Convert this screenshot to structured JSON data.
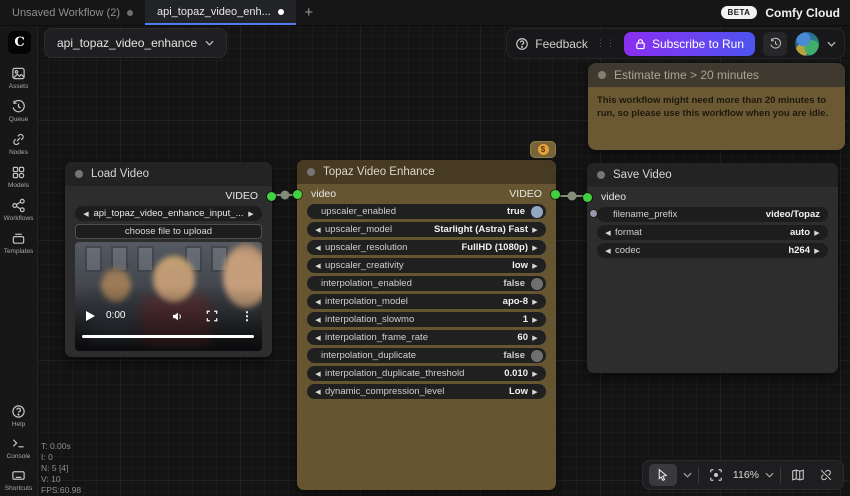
{
  "tab_bar": {
    "tabs": [
      {
        "label": "Unsaved Workflow (2)"
      },
      {
        "label": "api_topaz_video_enh..."
      }
    ],
    "new_tab_label": "+",
    "beta_badge": "BETA",
    "brand": "Comfy Cloud"
  },
  "menu_bar": {
    "workflow_name": "api_topaz_video_enhance",
    "feedback_label": "Feedback",
    "subscribe_label": "Subscribe to Run"
  },
  "notice": {
    "title": "Estimate time > 20 minutes",
    "body": "This workflow might need more than 20 minutes to run, so please use this workflow when you are idle."
  },
  "nodes": {
    "load_video": {
      "title": "Load Video",
      "output_label": "VIDEO",
      "file_value": "api_topaz_video_enhance_input_...",
      "upload_label": "choose file to upload",
      "player_time": "0:00"
    },
    "topaz": {
      "title": "Topaz Video Enhance",
      "input_label": "video",
      "output_label": "VIDEO",
      "cost_badge": "$",
      "widgets": [
        {
          "type": "toggle",
          "label": "upscaler_enabled",
          "value": "true"
        },
        {
          "type": "combo",
          "label": "upscaler_model",
          "value": "Starlight (Astra) Fast"
        },
        {
          "type": "combo",
          "label": "upscaler_resolution",
          "value": "FullHD (1080p)"
        },
        {
          "type": "combo",
          "label": "upscaler_creativity",
          "value": "low"
        },
        {
          "type": "toggle",
          "label": "interpolation_enabled",
          "value": "false"
        },
        {
          "type": "combo",
          "label": "interpolation_model",
          "value": "apo-8"
        },
        {
          "type": "combo",
          "label": "interpolation_slowmo",
          "value": "1"
        },
        {
          "type": "combo",
          "label": "interpolation_frame_rate",
          "value": "60"
        },
        {
          "type": "toggle",
          "label": "interpolation_duplicate",
          "value": "false"
        },
        {
          "type": "combo",
          "label": "interpolation_duplicate_threshold",
          "value": "0.010"
        },
        {
          "type": "combo",
          "label": "dynamic_compression_level",
          "value": "Low"
        }
      ]
    },
    "save_video": {
      "title": "Save Video",
      "input_label": "video",
      "widgets": [
        {
          "type": "text",
          "label": "filename_prefix",
          "value": "video/Topaz"
        },
        {
          "type": "combo",
          "label": "format",
          "value": "auto"
        },
        {
          "type": "combo",
          "label": "codec",
          "value": "h264"
        }
      ]
    }
  },
  "sidebar": {
    "top_items": [
      {
        "label": "Assets"
      },
      {
        "label": "Queue"
      },
      {
        "label": "Nodes"
      },
      {
        "label": "Models"
      },
      {
        "label": "Workflows"
      },
      {
        "label": "Templates"
      }
    ],
    "bottom_items": [
      {
        "label": "Help"
      },
      {
        "label": "Console"
      },
      {
        "label": "Shortcuts"
      }
    ]
  },
  "stats": [
    "T: 0.00s",
    "I: 0",
    "N: 5 [4]",
    "V: 10",
    "FPS:60.98"
  ],
  "canvas_toolbar": {
    "zoom_level": "116%"
  },
  "icons": {
    "arrow_left": "◀",
    "arrow_right": "▶",
    "kebab": "⋮",
    "drag_handle": "⋮⋮"
  },
  "colors": {
    "accent_blue": "#4f7df0",
    "subscribe_gradient_from": "#8a2ff0",
    "subscribe_gradient_to": "#4e54f0",
    "socket_green": "#3fd13f",
    "topaz_node_bg": "#655531",
    "topaz_node_header": "#463a22",
    "notice_bg": "#6a5933",
    "notice_header": "#3f3930",
    "toggle_on": "#93a7c4",
    "cost_coin": "#e6a23c"
  }
}
